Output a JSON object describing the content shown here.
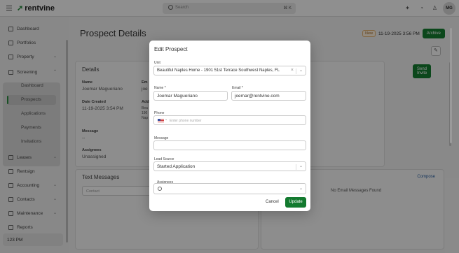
{
  "topbar": {
    "logo_text": "rentvine",
    "search_placeholder": "Search",
    "search_shortcut": "⌘ K",
    "avatar_initials": "MG"
  },
  "sidebar": {
    "items": [
      {
        "label": "Dashboard",
        "icon": "grid-icon"
      },
      {
        "label": "Portfolios",
        "icon": "folder-icon"
      },
      {
        "label": "Property",
        "icon": "building-icon"
      },
      {
        "label": "Screening",
        "icon": "clipboard-icon"
      },
      {
        "label": "Leases",
        "icon": "document-icon"
      },
      {
        "label": "Rentsign",
        "icon": "signature-icon"
      },
      {
        "label": "Accounting",
        "icon": "dollar-icon"
      },
      {
        "label": "Contacts",
        "icon": "contacts-icon"
      },
      {
        "label": "Maintenance",
        "icon": "wrench-icon"
      },
      {
        "label": "Reports",
        "icon": "chart-icon"
      }
    ],
    "screening_sub": [
      {
        "label": "Dashboard"
      },
      {
        "label": "Prospects"
      },
      {
        "label": "Applications"
      },
      {
        "label": "Payments"
      },
      {
        "label": "Invitations"
      }
    ],
    "time": "123 PM"
  },
  "page": {
    "title": "Prospect Details",
    "badge": "New",
    "date": "11-19-2025 3:56 PM",
    "archive_label": "Archive",
    "send_invite_label": "Send Invite"
  },
  "details": {
    "title": "Details",
    "name_label": "Name",
    "name_value": "Joemar Magueriano",
    "email_label_partial": "Em",
    "email_value_partial": "joe",
    "date_created_label": "Date Created",
    "date_created_value": "11-19-2025 3:54 PM",
    "address_label_partial": "Add",
    "address_lines_partial": [
      "Bea",
      "190",
      "Nap"
    ],
    "message_label": "Message",
    "message_value": "--",
    "assignees_label": "Assignees",
    "assignees_value": "Unassigned"
  },
  "text_messages": {
    "title": "Text Messages",
    "contact_placeholder": "Contact"
  },
  "email_panel": {
    "compose_label": "Compose",
    "empty_text": "No Email Messages Found"
  },
  "modal": {
    "title": "Edit Prospect",
    "unit_label": "Unit",
    "unit_value": "Beautiful Naples Home - 1901 51st Terrace Southwest Naples, FL",
    "name_label": "Name *",
    "name_value": "Joemar Magueriano",
    "email_label": "Email *",
    "email_value": "joemar@rentvine.com",
    "phone_label": "Phone",
    "phone_placeholder": "Enter phone number",
    "message_label": "Message",
    "message_value": "",
    "lead_source_label": "Lead Source",
    "lead_source_value": "Started Application",
    "assignees_label": "Assignees",
    "cancel_label": "Cancel",
    "update_label": "Update"
  },
  "colors": {
    "brand_green": "#137a2f",
    "overlay": "rgba(0,0,0,0.42)"
  }
}
